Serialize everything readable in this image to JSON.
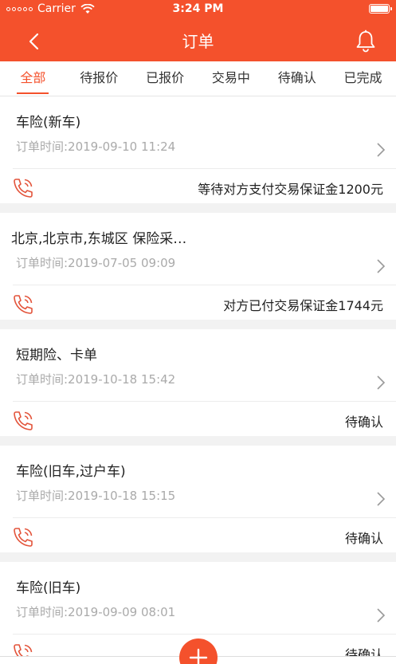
{
  "status_bar": {
    "carrier": "Carrier",
    "time": "3:24 PM"
  },
  "header": {
    "title": "订单"
  },
  "tabs": [
    {
      "label": "全部",
      "active": true
    },
    {
      "label": "待报价",
      "active": false
    },
    {
      "label": "已报价",
      "active": false
    },
    {
      "label": "交易中",
      "active": false
    },
    {
      "label": "待确认",
      "active": false
    },
    {
      "label": "已完成",
      "active": false
    }
  ],
  "orders": [
    {
      "title": "车险(新车)",
      "time": "订单时间:2019-09-10 11:24",
      "status": "等待对方支付交易保证金1200元"
    },
    {
      "title": "北京,北京市,东城区 保险采…",
      "time": "订单时间:2019-07-05 09:09",
      "status": "对方已付交易保证金1744元"
    },
    {
      "title": "短期险、卡单",
      "time": "订单时间:2019-10-18 15:42",
      "status": "待确认"
    },
    {
      "title": "车险(旧车,过户车)",
      "time": "订单时间:2019-10-18 15:15",
      "status": "待确认"
    },
    {
      "title": "车险(旧车)",
      "time": "订单时间:2019-09-09 08:01",
      "status": "待确认"
    }
  ],
  "colors": {
    "accent": "#f4512c",
    "muted": "#aaaaaa"
  },
  "icons": [
    "chevron-left-icon",
    "bell-icon",
    "phone-icon",
    "chevron-right-icon",
    "plus-icon",
    "wifi-icon",
    "battery-icon"
  ]
}
